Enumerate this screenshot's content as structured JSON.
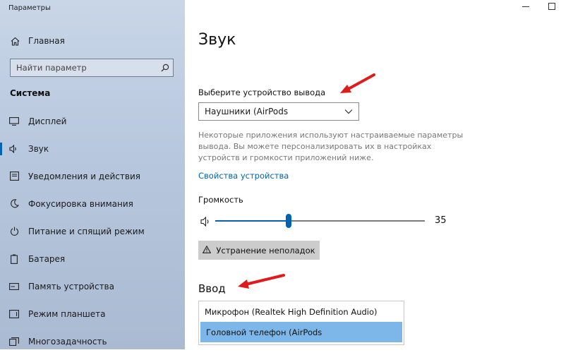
{
  "window": {
    "title": "Параметры",
    "minimize_icon": "minimize-icon",
    "maximize_icon": "maximize-icon"
  },
  "sidebar": {
    "home_label": "Главная",
    "search_placeholder": "Найти параметр",
    "section_title": "Система",
    "items": [
      {
        "label": "Дисплей",
        "icon": "display-icon"
      },
      {
        "label": "Звук",
        "icon": "sound-icon",
        "active": true
      },
      {
        "label": "Уведомления и действия",
        "icon": "notifications-icon"
      },
      {
        "label": "Фокусировка внимания",
        "icon": "moon-icon"
      },
      {
        "label": "Питание и спящий режим",
        "icon": "power-icon"
      },
      {
        "label": "Батарея",
        "icon": "battery-icon"
      },
      {
        "label": "Память устройства",
        "icon": "storage-icon"
      },
      {
        "label": "Режим планшета",
        "icon": "tablet-icon"
      },
      {
        "label": "Многозадачность",
        "icon": "multitask-icon"
      }
    ]
  },
  "main": {
    "title": "Звук",
    "output_label": "Выберите устройство вывода",
    "output_device": "Наушники (AirPods",
    "description": "Некоторые приложения используют настраиваемые параметры вывода. Вы можете персонализировать их в настройках устройств и громкости приложений ниже.",
    "device_properties_link": "Свойства устройства",
    "volume_label": "Громкость",
    "volume_value": "35",
    "volume_level": 0.35,
    "troubleshoot_label": "Устранение неполадок",
    "input_title": "Ввод",
    "input_options": [
      {
        "label": "Микрофон (Realtek High Definition Audio)",
        "selected": false
      },
      {
        "label": "Головной телефон (AirPods",
        "selected": true
      }
    ]
  },
  "colors": {
    "accent": "#0063b1",
    "annotation_arrow": "#e01b1b",
    "selected_option": "#7db7ea"
  }
}
